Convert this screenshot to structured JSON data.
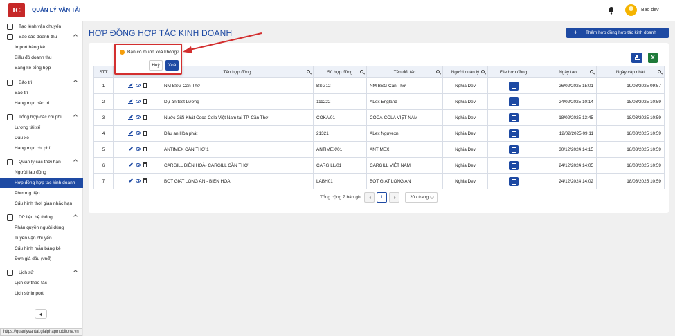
{
  "app": {
    "logo_text": "IC",
    "title": "QUẢN LÝ VẬN TẢI",
    "user": "Bao dev"
  },
  "sidebar": {
    "items": [
      {
        "type": "parent",
        "label": "Tạo lệnh vận chuyển",
        "icon": "edit-square-icon"
      },
      {
        "type": "parent",
        "label": "Báo cáo doanh thu",
        "icon": "table-icon",
        "expanded": true
      },
      {
        "type": "child",
        "label": "Import bảng kê"
      },
      {
        "type": "child",
        "label": "Biểu đồ doanh thu"
      },
      {
        "type": "child",
        "label": "Bảng kê tổng hợp"
      },
      {
        "type": "parent",
        "label": "Bảo trì",
        "icon": "wrench-icon",
        "expanded": true
      },
      {
        "type": "child",
        "label": "Bảo trì"
      },
      {
        "type": "child",
        "label": "Hạng mục bảo trì"
      },
      {
        "type": "parent",
        "label": "Tổng hợp các chi phí",
        "icon": "dollar-icon",
        "expanded": true
      },
      {
        "type": "child",
        "label": "Lương tài xế"
      },
      {
        "type": "child",
        "label": "Dầu xe"
      },
      {
        "type": "child",
        "label": "Hạng mục chi phí"
      },
      {
        "type": "parent",
        "label": "Quản lý các thời hạn",
        "icon": "clock-icon",
        "expanded": true
      },
      {
        "type": "child",
        "label": "Người lao động"
      },
      {
        "type": "child",
        "label": "Hợp đồng hợp tác kinh doanh",
        "active": true
      },
      {
        "type": "child",
        "label": "Phương tiện"
      },
      {
        "type": "child",
        "label": "Cấu hình thời gian nhắc hạn"
      },
      {
        "type": "parent",
        "label": "Dữ liệu hệ thống",
        "icon": "database-icon",
        "expanded": true
      },
      {
        "type": "child",
        "label": "Phân quyền người dùng"
      },
      {
        "type": "child",
        "label": "Tuyến vận chuyển"
      },
      {
        "type": "child",
        "label": "Cấu hình mẫu bảng kê"
      },
      {
        "type": "child",
        "label": "Đơn giá dầu (vnđ)"
      },
      {
        "type": "parent",
        "label": "Lịch sử",
        "icon": "history-icon",
        "expanded": true
      },
      {
        "type": "child",
        "label": "Lịch sử thao tác"
      },
      {
        "type": "child",
        "label": "Lịch sử import"
      }
    ]
  },
  "status_url": "https://quanlyvantai.giaiphapmobifone.vn",
  "page": {
    "title": "HỢP ĐỒNG HỢP TÁC KINH DOANH",
    "add_button": "Thêm hợp đồng hợp tác kinh doanh",
    "excel_label": "X"
  },
  "table": {
    "columns": [
      "STT",
      "",
      "Tên hợp đồng",
      "Số hợp đồng",
      "Tên đối tác",
      "Người quản lý",
      "File hợp đồng",
      "Ngày tạo",
      "Ngày cập nhật"
    ],
    "rows": [
      {
        "stt": "1",
        "name": "NM BSG Cần Thơ",
        "number": "BSG12",
        "partner": "NM BSG Cần Thơ",
        "manager": "Nghia Dev",
        "created": "26/02/2025 15:01",
        "updated": "19/03/2025 09:57"
      },
      {
        "stt": "2",
        "name": "Dự án test Lương",
        "number": "111222",
        "partner": "ALex England",
        "manager": "Nghia Dev",
        "created": "24/02/2025 10:14",
        "updated": "18/03/2025 10:59"
      },
      {
        "stt": "3",
        "name": "Nước Giải Khát Coca-Cola Việt Nam tại TP. Cần Thơ",
        "number": "COKA/01",
        "partner": "COCA-COLA VIỆT NAM",
        "manager": "Nghia Dev",
        "created": "18/02/2025 13:45",
        "updated": "18/03/2025 10:59"
      },
      {
        "stt": "4",
        "name": "Dầu an Hòa phát",
        "number": "21321",
        "partner": "ALex Nguyexn",
        "manager": "Nghia Dev",
        "created": "12/02/2025 09:11",
        "updated": "18/03/2025 10:59"
      },
      {
        "stt": "5",
        "name": "ANTIMEX CẦN THƠ 1",
        "number": "ANTIMEX/01",
        "partner": "ANTIMEX",
        "manager": "Nghia Dev",
        "created": "30/12/2024 14:15",
        "updated": "18/03/2025 10:59"
      },
      {
        "stt": "6",
        "name": "CARGILL BIÊN HOÀ- CARGILL CẦN THƠ",
        "number": "CARGILL/01",
        "partner": "CARGILL VIỆT NAM",
        "manager": "Nghia Dev",
        "created": "24/12/2024 14:05",
        "updated": "18/03/2025 10:59"
      },
      {
        "stt": "7",
        "name": "BOT GIAT LONG AN - BIEN HOA",
        "number": "LABH01",
        "partner": "BOT GIAT LONG AN",
        "manager": "Nghia Dev",
        "created": "24/12/2024 14:02",
        "updated": "18/03/2025 10:59"
      }
    ]
  },
  "pagination": {
    "total": "Tổng cộng 7 bản ghi",
    "current": "1",
    "page_size": "20 / trang"
  },
  "popconfirm": {
    "message": "Bạn có muốn xoá không?",
    "cancel": "Huỷ",
    "confirm": "Xoá"
  },
  "colors": {
    "primary": "#1e4aa3",
    "highlight": "#d32f2f",
    "warning": "#f59e0b",
    "excel": "#1f7a3a"
  }
}
